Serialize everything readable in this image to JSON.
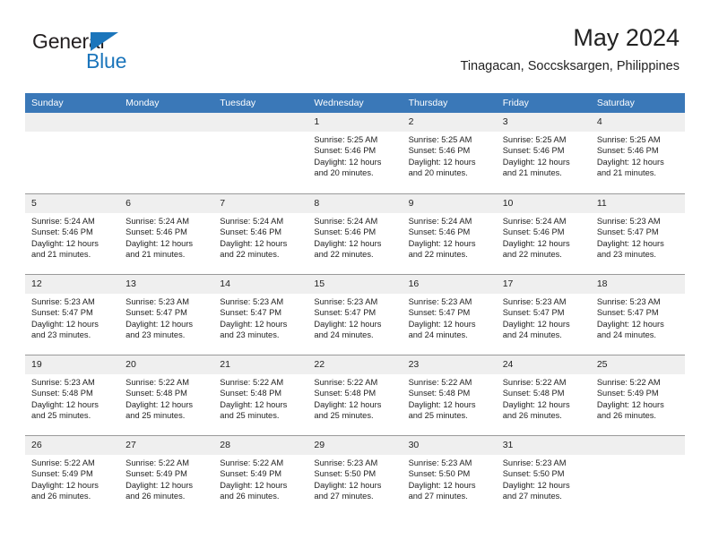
{
  "brand": {
    "name_top": "General",
    "name_bottom": "Blue",
    "accent_color": "#1b75bb"
  },
  "header": {
    "title": "May 2024",
    "subtitle": "Tinagacan, Soccsksargen, Philippines"
  },
  "theme": {
    "header_row_bg": "#3a78b8",
    "day_header_bg": "#efefef",
    "grid_line": "#9a9a9a",
    "text": "#222222"
  },
  "weekdays": [
    "Sunday",
    "Monday",
    "Tuesday",
    "Wednesday",
    "Thursday",
    "Friday",
    "Saturday"
  ],
  "calendar": {
    "month": "May",
    "year": "2024",
    "weeks": [
      [
        {
          "day": "",
          "empty": true
        },
        {
          "day": "",
          "empty": true
        },
        {
          "day": "",
          "empty": true
        },
        {
          "day": "1",
          "sunrise": "Sunrise: 5:25 AM",
          "sunset": "Sunset: 5:46 PM",
          "daylight1": "Daylight: 12 hours",
          "daylight2": "and 20 minutes."
        },
        {
          "day": "2",
          "sunrise": "Sunrise: 5:25 AM",
          "sunset": "Sunset: 5:46 PM",
          "daylight1": "Daylight: 12 hours",
          "daylight2": "and 20 minutes."
        },
        {
          "day": "3",
          "sunrise": "Sunrise: 5:25 AM",
          "sunset": "Sunset: 5:46 PM",
          "daylight1": "Daylight: 12 hours",
          "daylight2": "and 21 minutes."
        },
        {
          "day": "4",
          "sunrise": "Sunrise: 5:25 AM",
          "sunset": "Sunset: 5:46 PM",
          "daylight1": "Daylight: 12 hours",
          "daylight2": "and 21 minutes."
        }
      ],
      [
        {
          "day": "5",
          "sunrise": "Sunrise: 5:24 AM",
          "sunset": "Sunset: 5:46 PM",
          "daylight1": "Daylight: 12 hours",
          "daylight2": "and 21 minutes."
        },
        {
          "day": "6",
          "sunrise": "Sunrise: 5:24 AM",
          "sunset": "Sunset: 5:46 PM",
          "daylight1": "Daylight: 12 hours",
          "daylight2": "and 21 minutes."
        },
        {
          "day": "7",
          "sunrise": "Sunrise: 5:24 AM",
          "sunset": "Sunset: 5:46 PM",
          "daylight1": "Daylight: 12 hours",
          "daylight2": "and 22 minutes."
        },
        {
          "day": "8",
          "sunrise": "Sunrise: 5:24 AM",
          "sunset": "Sunset: 5:46 PM",
          "daylight1": "Daylight: 12 hours",
          "daylight2": "and 22 minutes."
        },
        {
          "day": "9",
          "sunrise": "Sunrise: 5:24 AM",
          "sunset": "Sunset: 5:46 PM",
          "daylight1": "Daylight: 12 hours",
          "daylight2": "and 22 minutes."
        },
        {
          "day": "10",
          "sunrise": "Sunrise: 5:24 AM",
          "sunset": "Sunset: 5:46 PM",
          "daylight1": "Daylight: 12 hours",
          "daylight2": "and 22 minutes."
        },
        {
          "day": "11",
          "sunrise": "Sunrise: 5:23 AM",
          "sunset": "Sunset: 5:47 PM",
          "daylight1": "Daylight: 12 hours",
          "daylight2": "and 23 minutes."
        }
      ],
      [
        {
          "day": "12",
          "sunrise": "Sunrise: 5:23 AM",
          "sunset": "Sunset: 5:47 PM",
          "daylight1": "Daylight: 12 hours",
          "daylight2": "and 23 minutes."
        },
        {
          "day": "13",
          "sunrise": "Sunrise: 5:23 AM",
          "sunset": "Sunset: 5:47 PM",
          "daylight1": "Daylight: 12 hours",
          "daylight2": "and 23 minutes."
        },
        {
          "day": "14",
          "sunrise": "Sunrise: 5:23 AM",
          "sunset": "Sunset: 5:47 PM",
          "daylight1": "Daylight: 12 hours",
          "daylight2": "and 23 minutes."
        },
        {
          "day": "15",
          "sunrise": "Sunrise: 5:23 AM",
          "sunset": "Sunset: 5:47 PM",
          "daylight1": "Daylight: 12 hours",
          "daylight2": "and 24 minutes."
        },
        {
          "day": "16",
          "sunrise": "Sunrise: 5:23 AM",
          "sunset": "Sunset: 5:47 PM",
          "daylight1": "Daylight: 12 hours",
          "daylight2": "and 24 minutes."
        },
        {
          "day": "17",
          "sunrise": "Sunrise: 5:23 AM",
          "sunset": "Sunset: 5:47 PM",
          "daylight1": "Daylight: 12 hours",
          "daylight2": "and 24 minutes."
        },
        {
          "day": "18",
          "sunrise": "Sunrise: 5:23 AM",
          "sunset": "Sunset: 5:47 PM",
          "daylight1": "Daylight: 12 hours",
          "daylight2": "and 24 minutes."
        }
      ],
      [
        {
          "day": "19",
          "sunrise": "Sunrise: 5:23 AM",
          "sunset": "Sunset: 5:48 PM",
          "daylight1": "Daylight: 12 hours",
          "daylight2": "and 25 minutes."
        },
        {
          "day": "20",
          "sunrise": "Sunrise: 5:22 AM",
          "sunset": "Sunset: 5:48 PM",
          "daylight1": "Daylight: 12 hours",
          "daylight2": "and 25 minutes."
        },
        {
          "day": "21",
          "sunrise": "Sunrise: 5:22 AM",
          "sunset": "Sunset: 5:48 PM",
          "daylight1": "Daylight: 12 hours",
          "daylight2": "and 25 minutes."
        },
        {
          "day": "22",
          "sunrise": "Sunrise: 5:22 AM",
          "sunset": "Sunset: 5:48 PM",
          "daylight1": "Daylight: 12 hours",
          "daylight2": "and 25 minutes."
        },
        {
          "day": "23",
          "sunrise": "Sunrise: 5:22 AM",
          "sunset": "Sunset: 5:48 PM",
          "daylight1": "Daylight: 12 hours",
          "daylight2": "and 25 minutes."
        },
        {
          "day": "24",
          "sunrise": "Sunrise: 5:22 AM",
          "sunset": "Sunset: 5:48 PM",
          "daylight1": "Daylight: 12 hours",
          "daylight2": "and 26 minutes."
        },
        {
          "day": "25",
          "sunrise": "Sunrise: 5:22 AM",
          "sunset": "Sunset: 5:49 PM",
          "daylight1": "Daylight: 12 hours",
          "daylight2": "and 26 minutes."
        }
      ],
      [
        {
          "day": "26",
          "sunrise": "Sunrise: 5:22 AM",
          "sunset": "Sunset: 5:49 PM",
          "daylight1": "Daylight: 12 hours",
          "daylight2": "and 26 minutes."
        },
        {
          "day": "27",
          "sunrise": "Sunrise: 5:22 AM",
          "sunset": "Sunset: 5:49 PM",
          "daylight1": "Daylight: 12 hours",
          "daylight2": "and 26 minutes."
        },
        {
          "day": "28",
          "sunrise": "Sunrise: 5:22 AM",
          "sunset": "Sunset: 5:49 PM",
          "daylight1": "Daylight: 12 hours",
          "daylight2": "and 26 minutes."
        },
        {
          "day": "29",
          "sunrise": "Sunrise: 5:23 AM",
          "sunset": "Sunset: 5:50 PM",
          "daylight1": "Daylight: 12 hours",
          "daylight2": "and 27 minutes."
        },
        {
          "day": "30",
          "sunrise": "Sunrise: 5:23 AM",
          "sunset": "Sunset: 5:50 PM",
          "daylight1": "Daylight: 12 hours",
          "daylight2": "and 27 minutes."
        },
        {
          "day": "31",
          "sunrise": "Sunrise: 5:23 AM",
          "sunset": "Sunset: 5:50 PM",
          "daylight1": "Daylight: 12 hours",
          "daylight2": "and 27 minutes."
        },
        {
          "day": "",
          "empty": true
        }
      ]
    ]
  }
}
